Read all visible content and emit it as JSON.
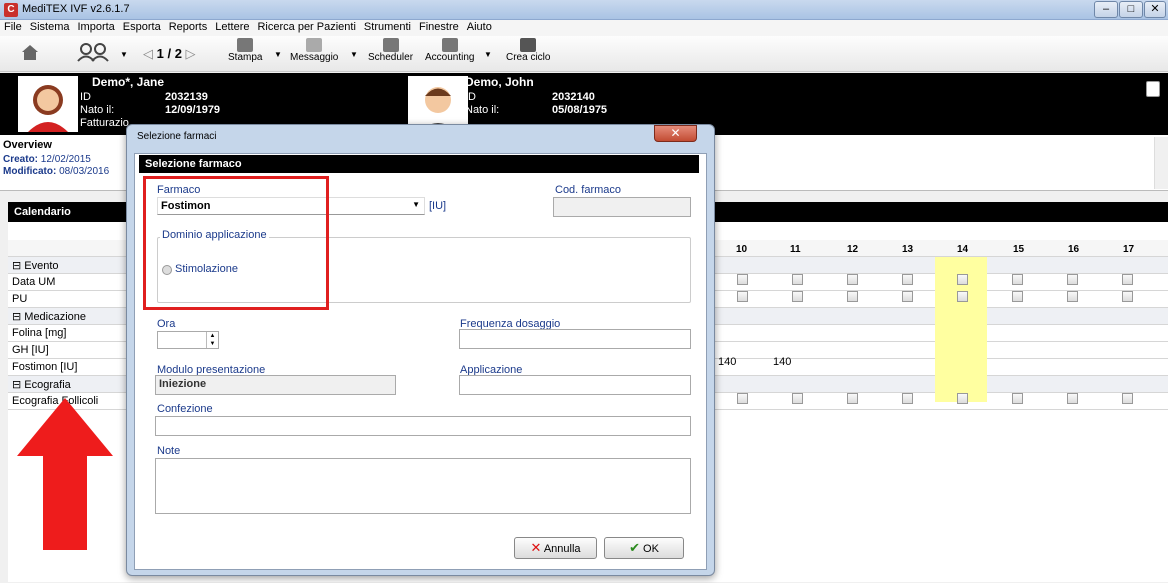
{
  "window": {
    "title": "MediTEX IVF v2.6.1.7"
  },
  "menu": [
    "File",
    "Sistema",
    "Importa",
    "Esporta",
    "Reports",
    "Lettere",
    "Ricerca per Pazienti",
    "Strumenti",
    "Finestre",
    "Aiuto"
  ],
  "toolbar": {
    "pager": "1 / 2",
    "stampa": "Stampa",
    "messaggio": "Messaggio",
    "scheduler": "Scheduler",
    "accounting": "Accounting",
    "crea_ciclo": "Crea ciclo"
  },
  "patient_f": {
    "name": "Demo*, Jane",
    "id_label": "ID",
    "id": "2032139",
    "dob_label": "Nato il:",
    "dob": "12/09/1979",
    "billing_label": "Fatturazio"
  },
  "patient_m": {
    "name": "Demo, John",
    "id_label": "ID",
    "id": "2032140",
    "dob_label": "Nato il:",
    "dob": "05/08/1975"
  },
  "overview": {
    "title": "Overview",
    "created_label": "Creato:",
    "created": "12/02/2015",
    "modified_label": "Modificato:",
    "modified": "08/03/2016"
  },
  "calendar": {
    "title": "Calendario",
    "days": [
      "10",
      "11",
      "12",
      "13",
      "14",
      "15",
      "16",
      "17"
    ],
    "rows": [
      "Evento",
      "Data UM",
      "PU",
      "Medicazione",
      "Folina [mg]",
      "GH [IU]",
      "Fostimon [IU]",
      "Ecografia",
      "Ecografia Follicoli"
    ],
    "fostimon_values": [
      "140",
      "140"
    ]
  },
  "dialog": {
    "window_title": "Selezione farmaci",
    "header": "Selezione farmaco",
    "farmaco_label": "Farmaco",
    "farmaco_value": "Fostimon",
    "unit": "[IU]",
    "cod_label": "Cod. farmaco",
    "dominio_label": "Dominio applicazione",
    "stimolazione": "Stimolazione",
    "ora_label": "Ora",
    "frequenza_label": "Frequenza dosaggio",
    "modulo_label": "Modulo presentazione",
    "modulo_value": "Iniezione",
    "applicazione_label": "Applicazione",
    "confezione_label": "Confezione",
    "note_label": "Note",
    "annulla": "Annulla",
    "ok": "OK"
  }
}
